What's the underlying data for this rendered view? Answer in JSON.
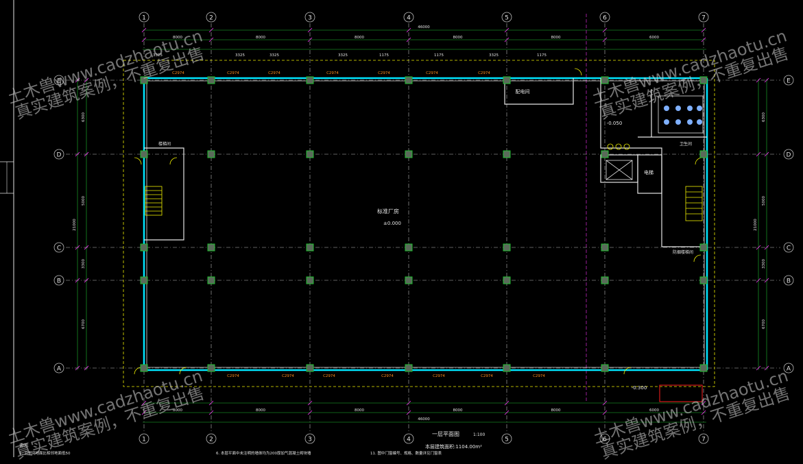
{
  "grid": {
    "columns": [
      "1",
      "2",
      "3",
      "4",
      "5",
      "6",
      "7"
    ],
    "rows": [
      "E",
      "D",
      "C",
      "B",
      "A"
    ]
  },
  "dimensions": {
    "overall_width": "46000",
    "bays_top": [
      "8000",
      "8000",
      "8000",
      "8000",
      "8000",
      "6000"
    ],
    "bays_bottom": [
      "8000",
      "8000",
      "8000",
      "8000",
      "8000",
      "6000"
    ],
    "overall_height": "21000",
    "rows_left": [
      "6300",
      "5000",
      "3300",
      "6700"
    ],
    "segment_notes": [
      "3325",
      "3325",
      "3325",
      "3325",
      "1175",
      "1175",
      "3325",
      "1175"
    ]
  },
  "rooms": {
    "hall_name": "标准厂房",
    "hall_elev": "±0.000",
    "distribution": "配电间",
    "stair_left_1": "楼梯间",
    "stair_right": "防烟楼梯间",
    "toilet": "卫生间",
    "elevator": "电梯",
    "wc_elev": "-0.050",
    "ramp_elev": "-0.300"
  },
  "window_tags": [
    "C2974",
    "C2974",
    "C2974",
    "C2974",
    "C2974",
    "C2974",
    "C2974"
  ],
  "drawing_title": "一层平面图",
  "scale": "1:100",
  "area_note": "本层建筑面积:1104.00m²",
  "notes": {
    "heading": "说明:",
    "n1": "1. 卫生间地面比相邻地面低50",
    "n6": "6. 本层平面中未注明的墙体均为200厚加气混凝土砌块墙",
    "n11": "11. 图中门窗编号、规格、数量详见门窗表"
  },
  "watermark": {
    "site": "土木兽www.cadzhaotu.cn",
    "slogan": "真实建筑案例，不重复出售"
  },
  "colors": {
    "cyan": "#00e5ff",
    "grid": "#bdbdbd",
    "green": "#1fbf2f",
    "magenta": "#ff33ff",
    "yellow": "#f0f000",
    "orange": "#ff8c1a",
    "white": "#e6e6e6",
    "red": "#ff2020"
  }
}
